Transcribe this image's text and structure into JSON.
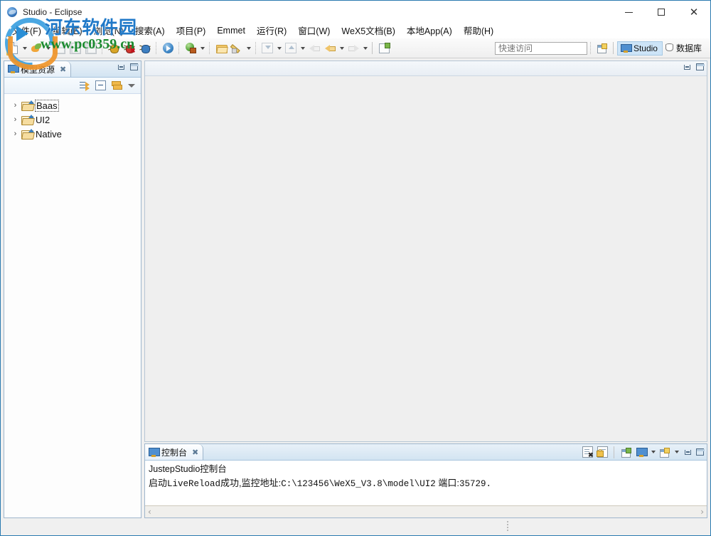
{
  "window": {
    "title": "Studio - Eclipse",
    "app_icon": "eclipse-globe-icon",
    "minimize_label": "Minimize",
    "maximize_label": "Maximize",
    "close_label": "Close"
  },
  "menubar": {
    "items": [
      {
        "label": "文件(F)",
        "name": "menu-file"
      },
      {
        "label": "编辑(E)",
        "name": "menu-edit"
      },
      {
        "label": "浏览(N)",
        "name": "menu-navigate"
      },
      {
        "label": "搜索(A)",
        "name": "menu-search"
      },
      {
        "label": "项目(P)",
        "name": "menu-project"
      },
      {
        "label": "Emmet",
        "name": "menu-emmet"
      },
      {
        "label": "运行(R)",
        "name": "menu-run"
      },
      {
        "label": "窗口(W)",
        "name": "menu-window"
      },
      {
        "label": "WeX5文档(B)",
        "name": "menu-wex5-docs"
      },
      {
        "label": "本地App(A)",
        "name": "menu-local-app"
      },
      {
        "label": "帮助(H)",
        "name": "menu-help"
      }
    ]
  },
  "toolbar": {
    "icons": [
      "new-file-icon",
      "new-wizard-dropdown",
      "publish-icon",
      "publish-dropdown",
      "save-icon",
      "save-all-icon",
      "print-icon",
      "debug-bug-icon",
      "debug-stop-bug-icon",
      "debug-blue-bug-icon",
      "run-play-icon",
      "run-server-icon",
      "run-dropdown",
      "open-resource-icon",
      "quick-fix-pen-icon",
      "quick-fix-dropdown",
      "next-annotation-icon",
      "next-annotation-dropdown",
      "previous-annotation-icon",
      "previous-annotation-dropdown",
      "back-history-icon",
      "back-arrow-icon",
      "back-dropdown",
      "forward-arrow-icon",
      "forward-dropdown",
      "new-window-icon"
    ]
  },
  "quick_access": {
    "placeholder": "快速访问",
    "value": ""
  },
  "perspectives": {
    "open_perspective_icon": "open-perspective-icon",
    "items": [
      {
        "label": "Studio",
        "icon": "studio-monitor-icon",
        "active": true
      },
      {
        "label": "数据库",
        "icon": "database-cylinder-icon",
        "active": false
      }
    ]
  },
  "left_view": {
    "tab_label": "模型资源",
    "tab_icon": "model-resource-icon",
    "tab_close_icon": "close-icon",
    "toolbar_icons": [
      "link-with-editor-icon",
      "collapse-all-icon",
      "sync-icon",
      "view-menu-icon"
    ],
    "minimize_icon": "minimize-icon",
    "maximize_icon": "maximize-icon",
    "tree": [
      {
        "label": "Baas",
        "twisty": "›",
        "icon": "folder-icon",
        "focused": true
      },
      {
        "label": "UI2",
        "twisty": "›",
        "icon": "folder-icon",
        "focused": false
      },
      {
        "label": "Native",
        "twisty": "›",
        "icon": "folder-icon",
        "focused": false
      }
    ]
  },
  "editor_area": {
    "minimize_icon": "minimize-icon",
    "maximize_icon": "maximize-icon",
    "content": ""
  },
  "console_view": {
    "tab_label": "控制台",
    "tab_icon": "console-icon",
    "tab_close_icon": "close-icon",
    "header": "JustepStudio控制台",
    "message_prefix": "启动",
    "message_mono1": "LiveReload",
    "message_mid": "成功,监控地址:",
    "message_path": "C:\\123456\\WeX5_V3.8\\model\\UI2",
    "message_port_label": " 端口:",
    "message_port": "35729.",
    "toolbar_icons": [
      "clear-console-icon",
      "scroll-lock-icon",
      "pin-console-icon",
      "display-selected-console-icon",
      "display-console-dropdown",
      "open-console-icon",
      "open-console-dropdown",
      "minimize-icon",
      "maximize-icon"
    ],
    "scroll_left_icon": "‹",
    "scroll_right_icon": "›"
  },
  "statusbar": {
    "grip_icon": "resize-grip-icon",
    "text": ""
  },
  "watermark": {
    "site_name": "河东软件园",
    "url": "www.pc0359.cn",
    "logo_icon": "site-logo-icon"
  },
  "colors": {
    "accent_blue": "#2a7ab0",
    "perspective_active_bg": "#cde4f7",
    "editor_bg": "#efefef",
    "view_tab_bg": "#d3e4f2",
    "watermark_blue": "#2079c8",
    "watermark_green": "#1a8a2e"
  }
}
